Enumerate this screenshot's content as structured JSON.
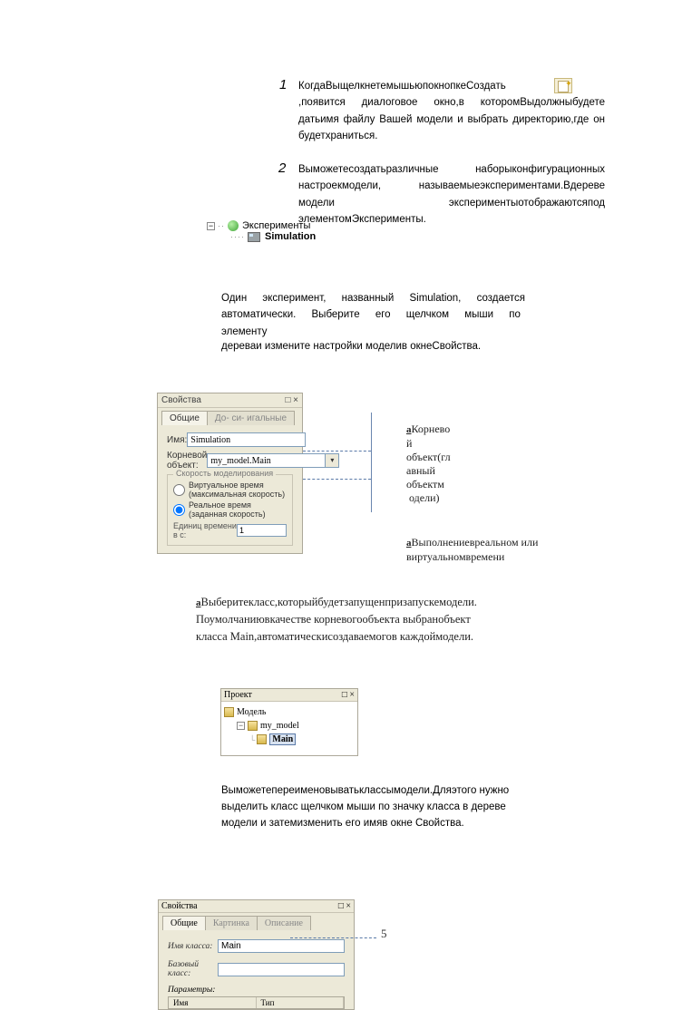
{
  "step1": {
    "num": "1",
    "text_a": "КогдаВыщелкнетемышьюпокнопкеСоздать",
    "text_b": ",появится диалоговое окно,в которомВыдолжныбудете датьимя файлу Вашей модели и выбрать директорию,где он будетхраниться."
  },
  "step2": {
    "num": "2",
    "text": "Выможетесоздатьразличные наборыконфигурационных настроекмодели, называемыеэкспериментами.Вдереве модели экспериментыотображаютсяпод элементомЭксперименты."
  },
  "exp_tree": {
    "root": "Эксперименты",
    "child": "Simulation"
  },
  "para3": "Один эксперимент, названный Simulation, создается автоматически. Выберите его щелчком мыши по элементу",
  "para3b": "дереваи измените настройки моделив окнеСвойства.",
  "panel1": {
    "title": "Свойства",
    "tab_active": "Общие",
    "tab_inactive": "До- си- игальные",
    "label_name": "Имя:",
    "value_name": "Simulation",
    "label_root": "Корневой объект:",
    "value_root": "my_model.Main",
    "group_title": "Скорость моделирования",
    "radio1": "Виртуальное время (максимальная скорость)",
    "radio2": "Реальное время (заданная скорость)",
    "scale_label": "Единиц времени в с:",
    "scale_value": "1"
  },
  "annot1": {
    "b": "a",
    "lines": [
      "Корнево",
      "й",
      "объект(гл",
      "авный",
      "объектм",
      "одели)"
    ]
  },
  "annot2": {
    "b": "a",
    "text": "Выполнениевреальном или виртуальномвремени"
  },
  "para4": {
    "b": "a",
    "text": "Выберитекласс,которыйбудетзапущенпризапускемодели. Поумолчаниювкачестве корневогообъекта выбранобъект класса Main,автоматическисоздаваемогов каждоймодели."
  },
  "panel2": {
    "title": "Проект",
    "node_model": "Модель",
    "node_mymodel": "my_model",
    "node_main": "Main"
  },
  "para5": "Выможетепереименовыватьклассымодели.Дляэтого нужно выделить класс щелчком мыши по значку класса в дереве модели и затемизменить его имяв окне Свойства.",
  "panel3": {
    "title": "Свойства",
    "tab1": "Общие",
    "tab2": "Картинка",
    "tab3": "Описание",
    "label_classname": "Имя класса:",
    "value_classname": "Main",
    "label_base": "Базовый класс:",
    "value_base": "",
    "label_params": "Параметры:",
    "col1": "Имя",
    "col2": "Тип"
  },
  "annot5": "5"
}
